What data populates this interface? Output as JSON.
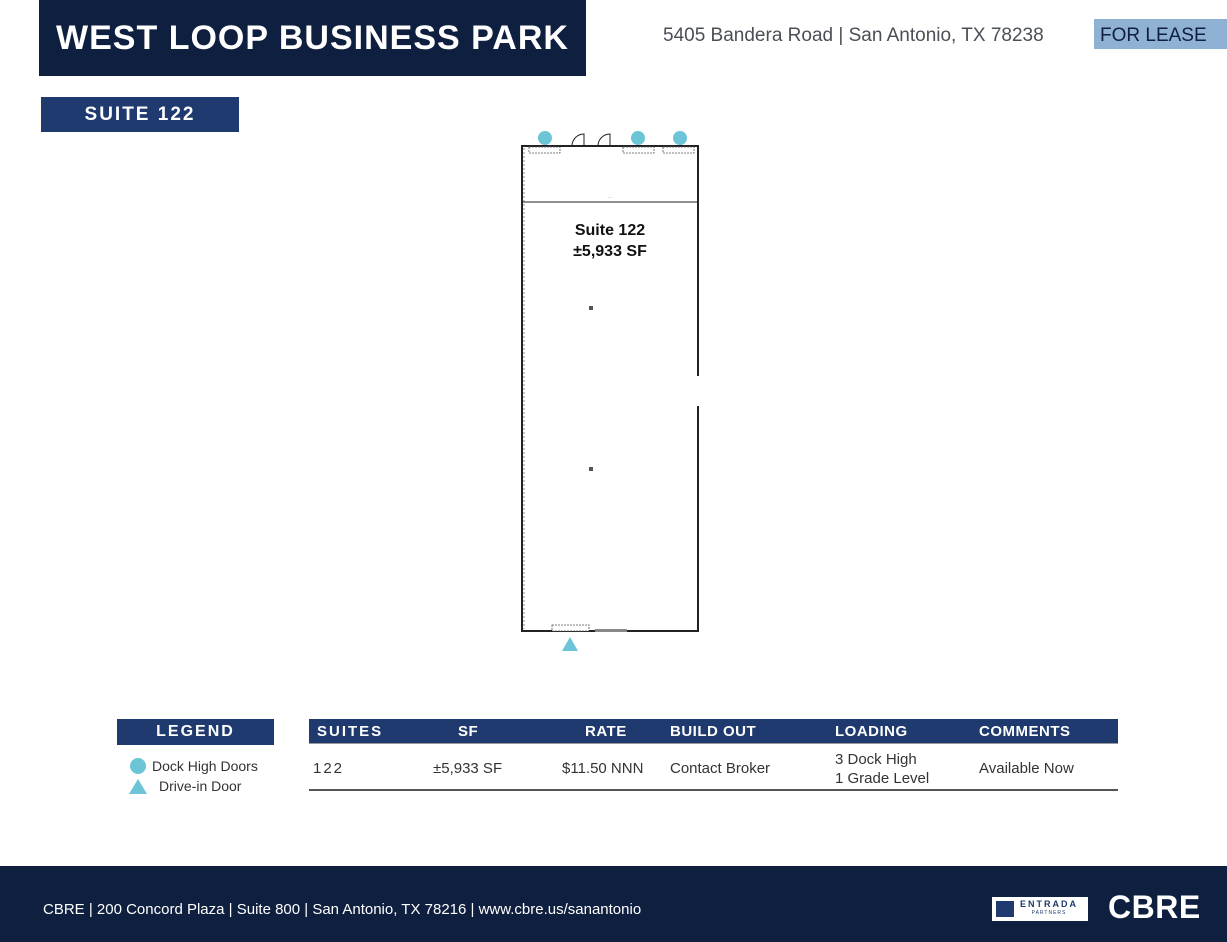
{
  "header": {
    "title": "WEST LOOP BUSINESS PARK",
    "address": "5405 Bandera Road | San Antonio, TX 78238",
    "status": "FOR LEASE"
  },
  "suite_tag": "SUITE 122",
  "floor_plan": {
    "suite_name": "Suite 122",
    "suite_size": "±5,933 SF"
  },
  "legend": {
    "title": "LEGEND",
    "items": [
      {
        "icon": "circle-icon",
        "label": "Dock High Doors",
        "color": "#6cc5d6"
      },
      {
        "icon": "triangle-icon",
        "label": "Drive-in Door",
        "color": "#6cc5d6"
      }
    ]
  },
  "table": {
    "headers": [
      "SUITES",
      "SF",
      "RATE",
      "BUILD OUT",
      "LOADING",
      "COMMENTS"
    ],
    "rows": [
      {
        "suite": "122",
        "sf": "±5,933 SF",
        "rate": "$11.50 NNN",
        "build_out": "Contact Broker",
        "loading_1": "3 Dock High",
        "loading_2": "1 Grade Level",
        "comments": "Available Now"
      }
    ]
  },
  "footer": {
    "contact": "CBRE | 200 Concord Plaza | Suite 800 | San Antonio, TX 78216  |  www.cbre.us/sanantonio",
    "partner_logo": "ENTRADA",
    "partner_sub": "PARTNERS",
    "brand_logo": "CBRE"
  },
  "colors": {
    "navy": "#0f1f3f",
    "accent_blue": "#1f3a6e",
    "lease_tag": "#8fb2d4",
    "marker": "#6cc5d6"
  }
}
